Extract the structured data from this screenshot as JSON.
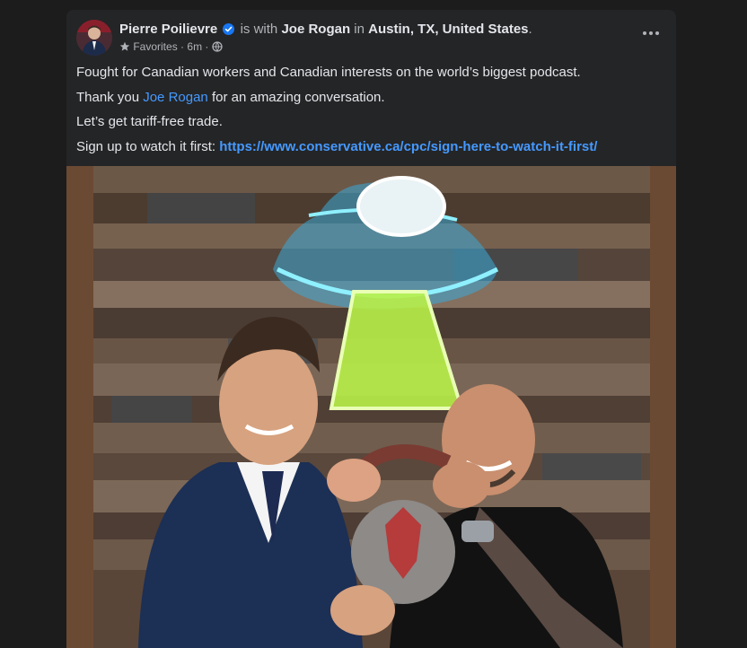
{
  "post": {
    "author": "Pierre Poilievre",
    "is_with_text": "is with",
    "tagged_person": "Joe Rogan",
    "in_text": "in",
    "location": "Austin, TX, United States",
    "period": ".",
    "audience": "Favorites",
    "timestamp": "6m",
    "separator": "·",
    "icons": {
      "verified": "verified-badge-icon",
      "favorites": "star-icon",
      "privacy": "globe-icon",
      "more": "more-options-icon"
    },
    "colors": {
      "link": "#4599ff",
      "verified": "#1877f2",
      "card_bg": "#242526",
      "page_bg": "#1c1c1d"
    },
    "text": {
      "line1": "Fought for Canadian workers and Canadian interests on the world’s biggest podcast.",
      "line2_prefix": "Thank you ",
      "line2_mention": "Joe Rogan",
      "line2_suffix": " for an amazing conversation.",
      "line3": "Let’s get tariff-free trade.",
      "line4_prefix": "Sign up to watch it first: ",
      "line4_link": "https://www.conservative.ca/cpc/sign-here-to-watch-it-first/"
    }
  }
}
